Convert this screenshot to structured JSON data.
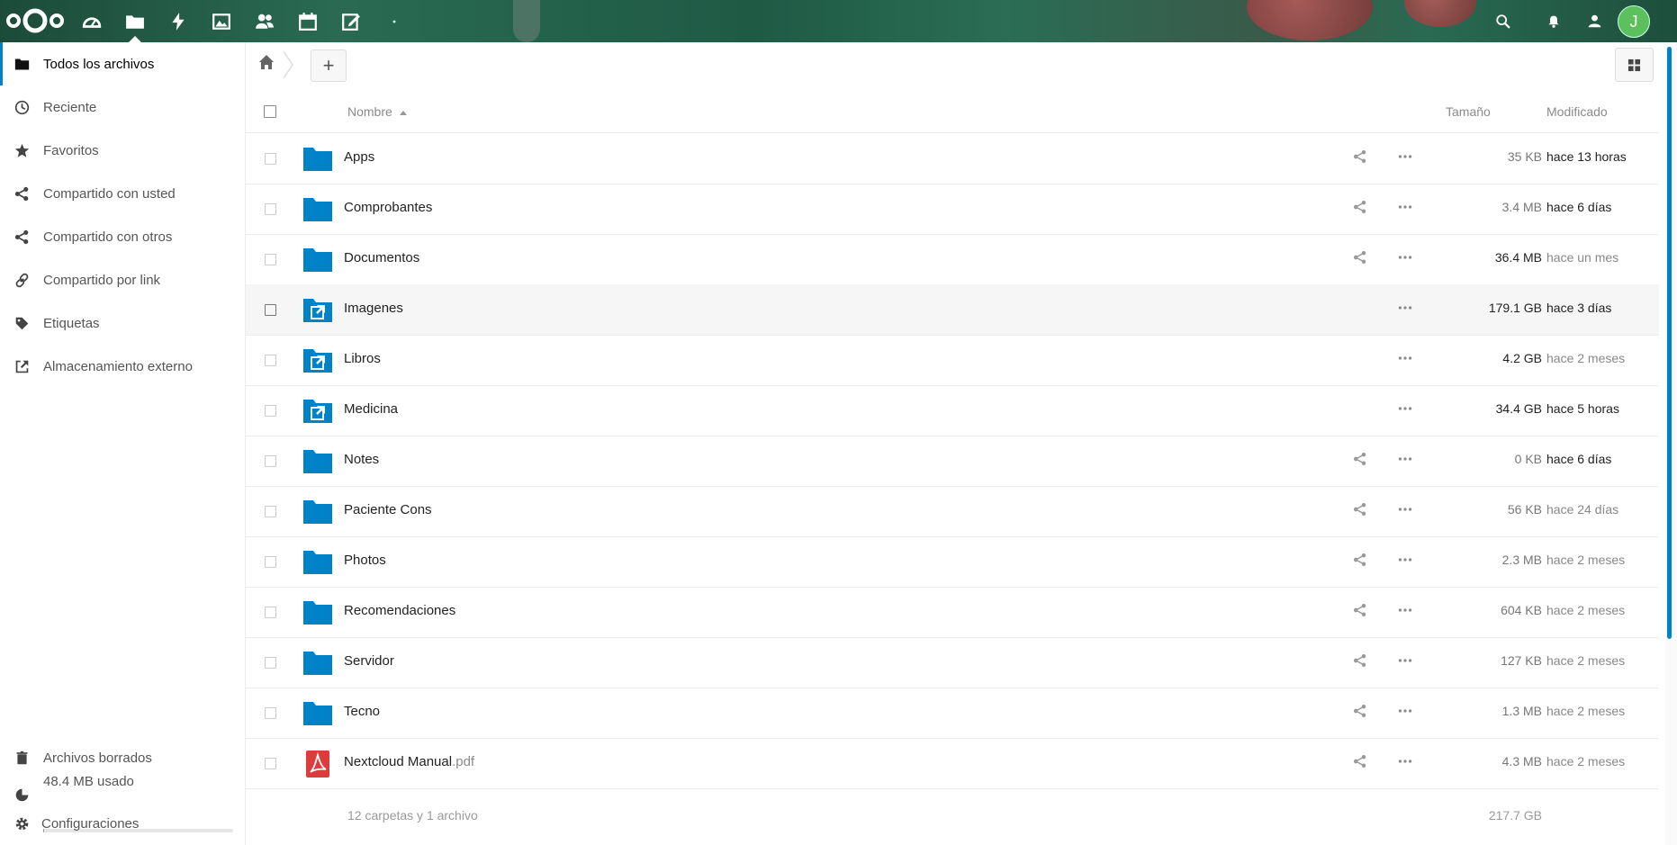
{
  "header": {
    "apps": [
      {
        "name": "dashboard-icon"
      },
      {
        "name": "files-icon",
        "active": true
      },
      {
        "name": "activity-icon"
      },
      {
        "name": "gallery-icon"
      },
      {
        "name": "contacts-icon"
      },
      {
        "name": "calendar-icon"
      },
      {
        "name": "notes-icon"
      },
      {
        "name": "more-apps-icon"
      }
    ],
    "right_icons": [
      "search-icon",
      "notifications-icon",
      "contacts-menu-icon"
    ],
    "avatar_letter": "J",
    "avatar_color": "#5cc15c"
  },
  "sidebar": {
    "items": [
      {
        "label": "Todos los archivos",
        "icon": "folder-icon",
        "active": true
      },
      {
        "label": "Reciente",
        "icon": "clock-icon"
      },
      {
        "label": "Favoritos",
        "icon": "star-icon"
      },
      {
        "label": "Compartido con usted",
        "icon": "share-icon"
      },
      {
        "label": "Compartido con otros",
        "icon": "share-icon"
      },
      {
        "label": "Compartido por link",
        "icon": "link-icon"
      },
      {
        "label": "Etiquetas",
        "icon": "tag-icon"
      },
      {
        "label": "Almacenamiento externo",
        "icon": "external-icon"
      }
    ],
    "deleted": "Archivos borrados",
    "quota": "48.4 MB usado",
    "quota_percent": 0.5,
    "settings": "Configuraciones"
  },
  "controls": {
    "new_label": "+"
  },
  "table": {
    "headers": {
      "name": "Nombre",
      "size": "Tamaño",
      "modified": "Modificado"
    },
    "rows": [
      {
        "name": "Apps",
        "ext": "",
        "type": "folder",
        "share": true,
        "size": "35 KB",
        "size_dark": false,
        "modified": "hace 13 horas",
        "mod_dark": true
      },
      {
        "name": "Comprobantes",
        "ext": "",
        "type": "folder",
        "share": true,
        "size": "3.4 MB",
        "size_dark": false,
        "modified": "hace 6 días",
        "mod_dark": true
      },
      {
        "name": "Documentos",
        "ext": "",
        "type": "folder",
        "share": true,
        "size": "36.4 MB",
        "size_dark": true,
        "modified": "hace un mes",
        "mod_dark": false
      },
      {
        "name": "Imagenes",
        "ext": "",
        "type": "external",
        "share": false,
        "size": "179.1 GB",
        "size_dark": true,
        "modified": "hace 3 días",
        "mod_dark": true,
        "hover": true
      },
      {
        "name": "Libros",
        "ext": "",
        "type": "external",
        "share": false,
        "size": "4.2 GB",
        "size_dark": true,
        "modified": "hace 2 meses",
        "mod_dark": false
      },
      {
        "name": "Medicina",
        "ext": "",
        "type": "external",
        "share": false,
        "size": "34.4 GB",
        "size_dark": true,
        "modified": "hace 5 horas",
        "mod_dark": true
      },
      {
        "name": "Notes",
        "ext": "",
        "type": "folder",
        "share": true,
        "size": "0 KB",
        "size_dark": false,
        "modified": "hace 6 días",
        "mod_dark": true
      },
      {
        "name": "Paciente Cons",
        "ext": "",
        "type": "folder",
        "share": true,
        "size": "56 KB",
        "size_dark": false,
        "modified": "hace 24 días",
        "mod_dark": false
      },
      {
        "name": "Photos",
        "ext": "",
        "type": "folder",
        "share": true,
        "size": "2.3 MB",
        "size_dark": false,
        "modified": "hace 2 meses",
        "mod_dark": false
      },
      {
        "name": "Recomendaciones",
        "ext": "",
        "type": "folder",
        "share": true,
        "size": "604 KB",
        "size_dark": false,
        "modified": "hace 2 meses",
        "mod_dark": false
      },
      {
        "name": "Servidor",
        "ext": "",
        "type": "folder",
        "share": true,
        "size": "127 KB",
        "size_dark": false,
        "modified": "hace 2 meses",
        "mod_dark": false
      },
      {
        "name": "Tecno",
        "ext": "",
        "type": "folder",
        "share": true,
        "size": "1.3 MB",
        "size_dark": false,
        "modified": "hace 2 meses",
        "mod_dark": false
      },
      {
        "name": "Nextcloud Manual",
        "ext": ".pdf",
        "type": "pdf",
        "share": true,
        "size": "4.3 MB",
        "size_dark": false,
        "modified": "hace 2 meses",
        "mod_dark": false
      }
    ],
    "summary": "12 carpetas y 1 archivo",
    "total": "217.7 GB"
  },
  "colors": {
    "accent": "#0082c9",
    "folder": "#0082c9",
    "pdf": "#dc3c3c"
  }
}
